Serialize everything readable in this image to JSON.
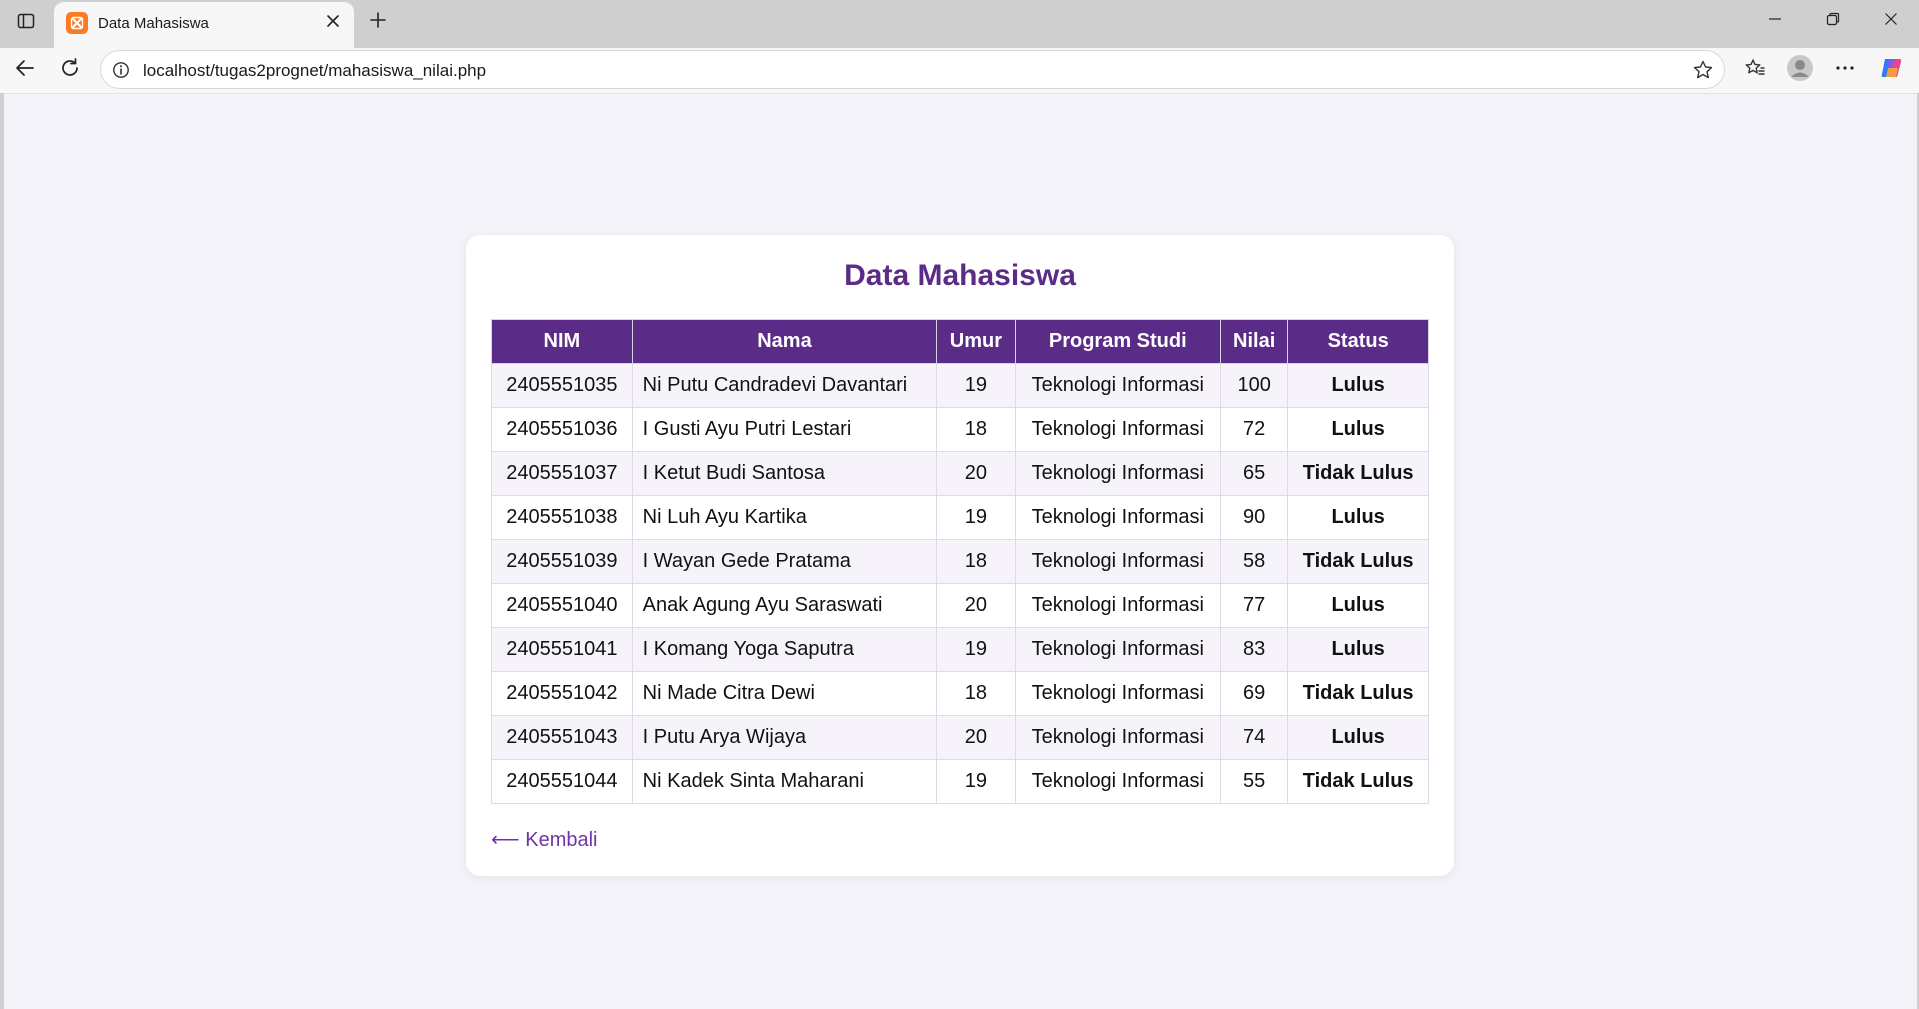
{
  "browser": {
    "tab_title": "Data Mahasiswa",
    "url": "localhost/tugas2prognet/mahasiswa_nilai.php"
  },
  "page": {
    "title": "Data Mahasiswa",
    "back_link": "⟵ Kembali"
  },
  "table": {
    "headers": {
      "nim": "NIM",
      "nama": "Nama",
      "umur": "Umur",
      "prodi": "Program Studi",
      "nilai": "Nilai",
      "status": "Status"
    },
    "rows": [
      {
        "nim": "2405551035",
        "nama": "Ni Putu Candradevi Davantari",
        "umur": "19",
        "prodi": "Teknologi Informasi",
        "nilai": "100",
        "status": "Lulus"
      },
      {
        "nim": "2405551036",
        "nama": "I Gusti Ayu Putri Lestari",
        "umur": "18",
        "prodi": "Teknologi Informasi",
        "nilai": "72",
        "status": "Lulus"
      },
      {
        "nim": "2405551037",
        "nama": "I Ketut Budi Santosa",
        "umur": "20",
        "prodi": "Teknologi Informasi",
        "nilai": "65",
        "status": "Tidak Lulus"
      },
      {
        "nim": "2405551038",
        "nama": "Ni Luh Ayu Kartika",
        "umur": "19",
        "prodi": "Teknologi Informasi",
        "nilai": "90",
        "status": "Lulus"
      },
      {
        "nim": "2405551039",
        "nama": "I Wayan Gede Pratama",
        "umur": "18",
        "prodi": "Teknologi Informasi",
        "nilai": "58",
        "status": "Tidak Lulus"
      },
      {
        "nim": "2405551040",
        "nama": "Anak Agung Ayu Saraswati",
        "umur": "20",
        "prodi": "Teknologi Informasi",
        "nilai": "77",
        "status": "Lulus"
      },
      {
        "nim": "2405551041",
        "nama": "I Komang Yoga Saputra",
        "umur": "19",
        "prodi": "Teknologi Informasi",
        "nilai": "83",
        "status": "Lulus"
      },
      {
        "nim": "2405551042",
        "nama": "Ni Made Citra Dewi",
        "umur": "18",
        "prodi": "Teknologi Informasi",
        "nilai": "69",
        "status": "Tidak Lulus"
      },
      {
        "nim": "2405551043",
        "nama": "I Putu Arya Wijaya",
        "umur": "20",
        "prodi": "Teknologi Informasi",
        "nilai": "74",
        "status": "Lulus"
      },
      {
        "nim": "2405551044",
        "nama": "Ni Kadek Sinta Maharani",
        "umur": "19",
        "prodi": "Teknologi Informasi",
        "nilai": "55",
        "status": "Tidak Lulus"
      }
    ]
  },
  "colors": {
    "accent": "#5b2c87",
    "lulus": "#12820f",
    "tidak_lulus": "#e8161b",
    "row_alt": "#f6f3fb",
    "page_background": "#f4f3f9"
  },
  "icons": {
    "sidebar": "sidebar-icon",
    "favicon": "xampp-favicon-icon",
    "tab_close": "close-icon",
    "new_tab": "plus-icon",
    "minimize": "minimize-icon",
    "restore": "restore-icon",
    "close_window": "close-icon",
    "back": "back-arrow-icon",
    "refresh": "refresh-icon",
    "site_info": "info-icon",
    "favorite": "star-icon",
    "favorites": "favorites-icon",
    "profile": "profile-icon",
    "more": "more-icon",
    "copilot": "copilot-icon"
  }
}
